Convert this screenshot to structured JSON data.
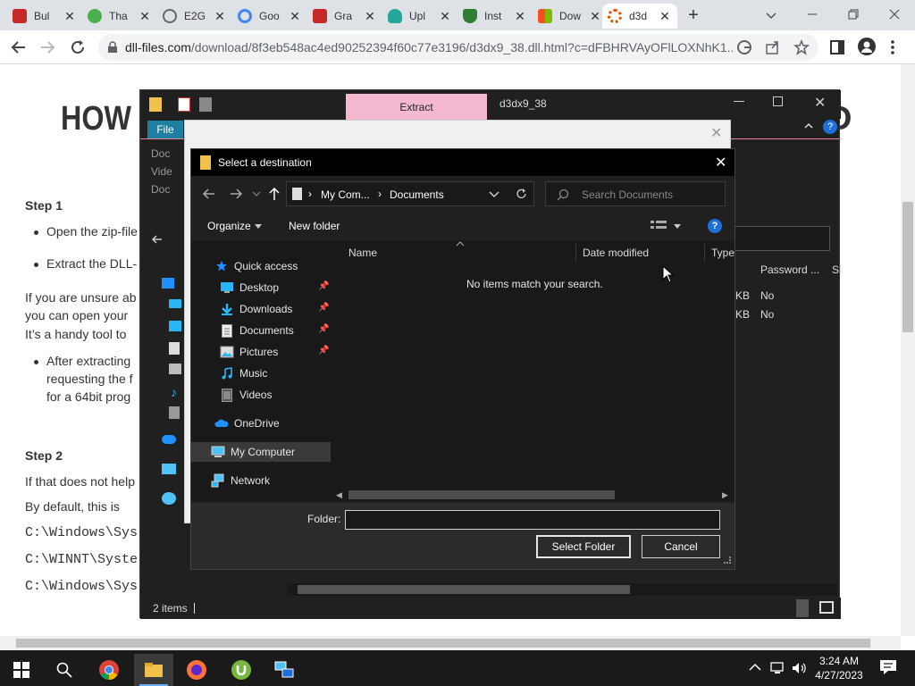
{
  "browser": {
    "tabs": [
      {
        "label": "Bul",
        "favicon": "red-pen-icon",
        "color": "#c62828"
      },
      {
        "label": "Tha",
        "favicon": "utorrent-icon",
        "color": "#4caf50"
      },
      {
        "label": "E2G",
        "favicon": "globe-icon",
        "color": "#666666"
      },
      {
        "label": "Goo",
        "favicon": "google-icon",
        "color": "#4285f4"
      },
      {
        "label": "Gra",
        "favicon": "red-pen-icon",
        "color": "#c62828"
      },
      {
        "label": "Upl",
        "favicon": "cloud-upload-icon",
        "color": "#26a69a"
      },
      {
        "label": "Inst",
        "favicon": "shield-check-icon",
        "color": "#2e7d32"
      },
      {
        "label": "Dow",
        "favicon": "microsoft-icon",
        "color": "#f25022"
      },
      {
        "label": "d3d",
        "favicon": "gear-icon",
        "color": "#e65100",
        "active": true
      }
    ],
    "new_tab_symbol": "+",
    "address": {
      "host": "dll-files.com",
      "path": "/download/8f3eb548ac4ed90252394f60c77e3196/d3dx9_38.dll.html?c=dFBHRVAyOFlLOXNhK1..."
    }
  },
  "page": {
    "heading_start": "HOW",
    "heading_end": "D",
    "step1": "Step 1",
    "line_open": "Open the zip-file",
    "line_extract": "Extract the DLL-",
    "line_unsure1": "If you are unsure ab",
    "line_unsure2": "you can open your",
    "line_unsure3": "It’s a handy tool to",
    "line_after1": "After extracting",
    "line_after2": "requesting the f",
    "line_after3": "for a 64bit prog",
    "step2": "Step 2",
    "line_ifthat": "If that does not help",
    "line_default": "By default, this is",
    "code1": "C:\\Windows\\Sys",
    "code2": "C:\\WINNT\\Syste",
    "code3": "C:\\Windows\\Sys"
  },
  "explorer": {
    "extract_tab": "Extract",
    "title": "d3dx9_38",
    "file_tab": "File",
    "quick_items": [
      "Doc",
      "Vide",
      "Doc"
    ],
    "col_password": "Password ...",
    "col_size": "Si",
    "row1": {
      "size_unit": "KB",
      "password": "No"
    },
    "row2": {
      "size_unit": "KB",
      "password": "No"
    },
    "status": "2 items"
  },
  "dialog": {
    "title": "Select a destination",
    "breadcrumb": [
      "My Com...",
      "Documents"
    ],
    "search_placeholder": "Search Documents",
    "organize": "Organize",
    "new_folder": "New folder",
    "columns": {
      "name": "Name",
      "date": "Date modified",
      "type": "Type"
    },
    "empty_message": "No items match your search.",
    "nav": {
      "quick_access": "Quick access",
      "desktop": "Desktop",
      "downloads": "Downloads",
      "documents": "Documents",
      "pictures": "Pictures",
      "music": "Music",
      "videos": "Videos",
      "onedrive": "OneDrive",
      "my_computer": "My Computer",
      "network": "Network"
    },
    "folder_label": "Folder:",
    "folder_value": "",
    "select_button": "Select Folder",
    "cancel_button": "Cancel"
  },
  "taskbar": {
    "time": "3:24 AM",
    "date": "4/27/2023"
  }
}
